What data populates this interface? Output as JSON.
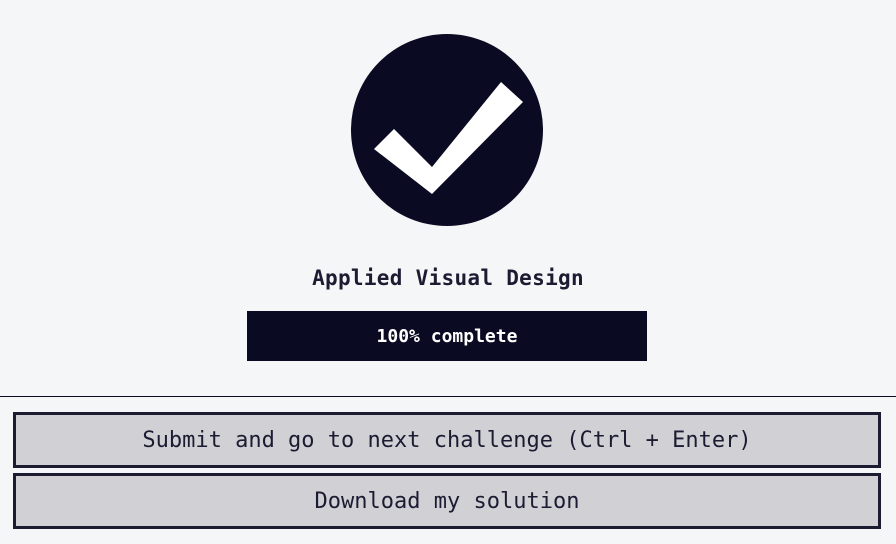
{
  "completion": {
    "icon": "check-circle-icon",
    "accent_color": "#0a0a23"
  },
  "section": {
    "title": "Applied Visual Design"
  },
  "progress": {
    "percent": 100,
    "label": "100% complete"
  },
  "actions": {
    "submit_label": "Submit and go to next challenge (Ctrl + Enter)",
    "download_label": "Download my solution"
  }
}
